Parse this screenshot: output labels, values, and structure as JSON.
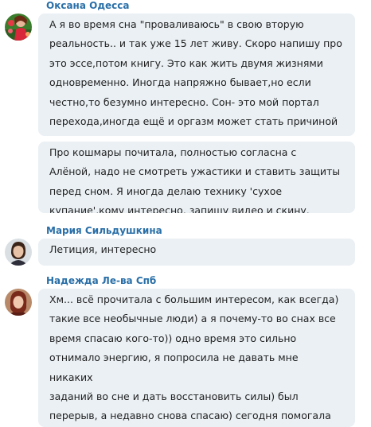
{
  "colors": {
    "author_name": "#2a6fa8",
    "bubble_background": "#eaf0f4",
    "message_text": "#222222"
  },
  "messages": [
    {
      "author": "Оксана Одесса",
      "avatar_icon": "user-avatar-oksana",
      "bubbles": [
        "А я во время сна \"проваливаюсь\" в свою вторую\nреальность.. и так уже 15 лет живу. Скоро напишу про\nэто эссе,потом книгу. Это как жить двумя жизнями\nодновременно. Иногда напряжно бывает,но если\nчестно,то безумно интересно. Сон- это мой портал\nперехода,иногда ещё и оргазм может стать причиной\nскачка.",
        "Про кошмары почитала, полностью согласна с\nАлёной, надо не смотреть ужастики и ставить защиты\nперед сном. Я иногда делаю технику 'сухое\nкупание',кому интересно, запишу видео и скину."
      ]
    },
    {
      "author": "Мария Сильдушкина",
      "avatar_icon": "user-avatar-maria",
      "bubbles": [
        "Летиция, интересно"
      ]
    },
    {
      "author": "Надежда Ле-ва Спб",
      "avatar_icon": "user-avatar-nadezhda",
      "bubbles": [
        "Хм... всё прочитала с большим интересом, как всегда)\nтакие все необычные люди) а я почему-то во снах все\nвремя спасаю кого-то)) одно время это сильно\nотнимало энергию, я попросила не давать мне никаких\nзаданий во сне и дать восстановить силы) был\nперерыв, а недавно снова спасаю) сегодня помогала\nмужчине-инвалиду) интересно, почему именно такой\nспособ съёма энергии?"
      ]
    }
  ]
}
